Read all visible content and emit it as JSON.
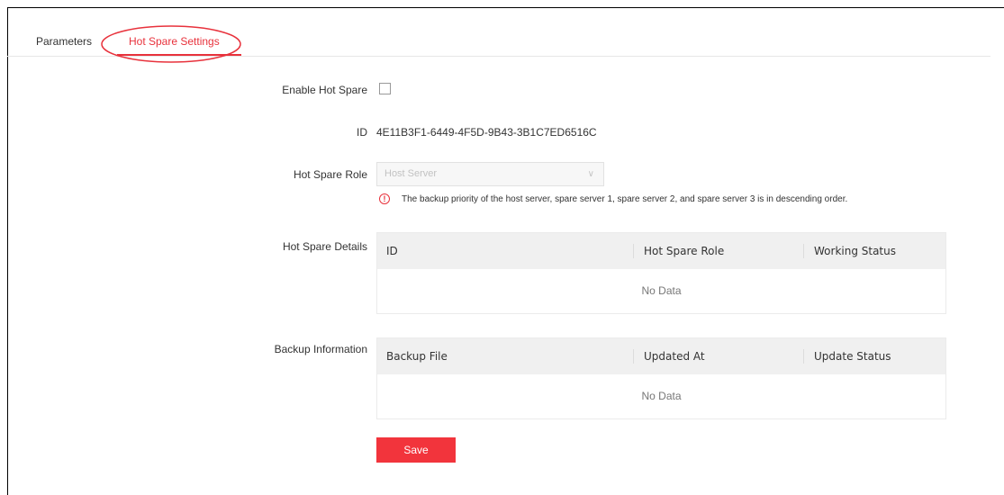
{
  "tabs": [
    {
      "label": "Parameters",
      "active": false
    },
    {
      "label": "Hot Spare Settings",
      "active": true
    }
  ],
  "form": {
    "enable_label": "Enable Hot Spare",
    "enable_checked": false,
    "id_label": "ID",
    "id_value": "4E11B3F1-6449-4F5D-9B43-3B1C7ED6516C",
    "role_label": "Hot Spare Role",
    "role_value": "Host Server",
    "role_note": "The backup priority of the host server, spare server 1, spare server 2, and spare server 3 is in descending order.",
    "details_label": "Hot Spare Details",
    "backup_label": "Backup Information"
  },
  "details_table": {
    "columns": [
      "ID",
      "Hot Spare Role",
      "Working Status"
    ],
    "empty_text": "No Data"
  },
  "backup_table": {
    "columns": [
      "Backup File",
      "Updated At",
      "Update Status"
    ],
    "empty_text": "No Data"
  },
  "save_label": "Save",
  "colors": {
    "accent": "#e8323c",
    "button": "#f2343c",
    "header_bg": "#f0f0f0"
  },
  "icons": {
    "warning": "exclamation-circle-icon",
    "dropdown": "chevron-down-icon"
  }
}
